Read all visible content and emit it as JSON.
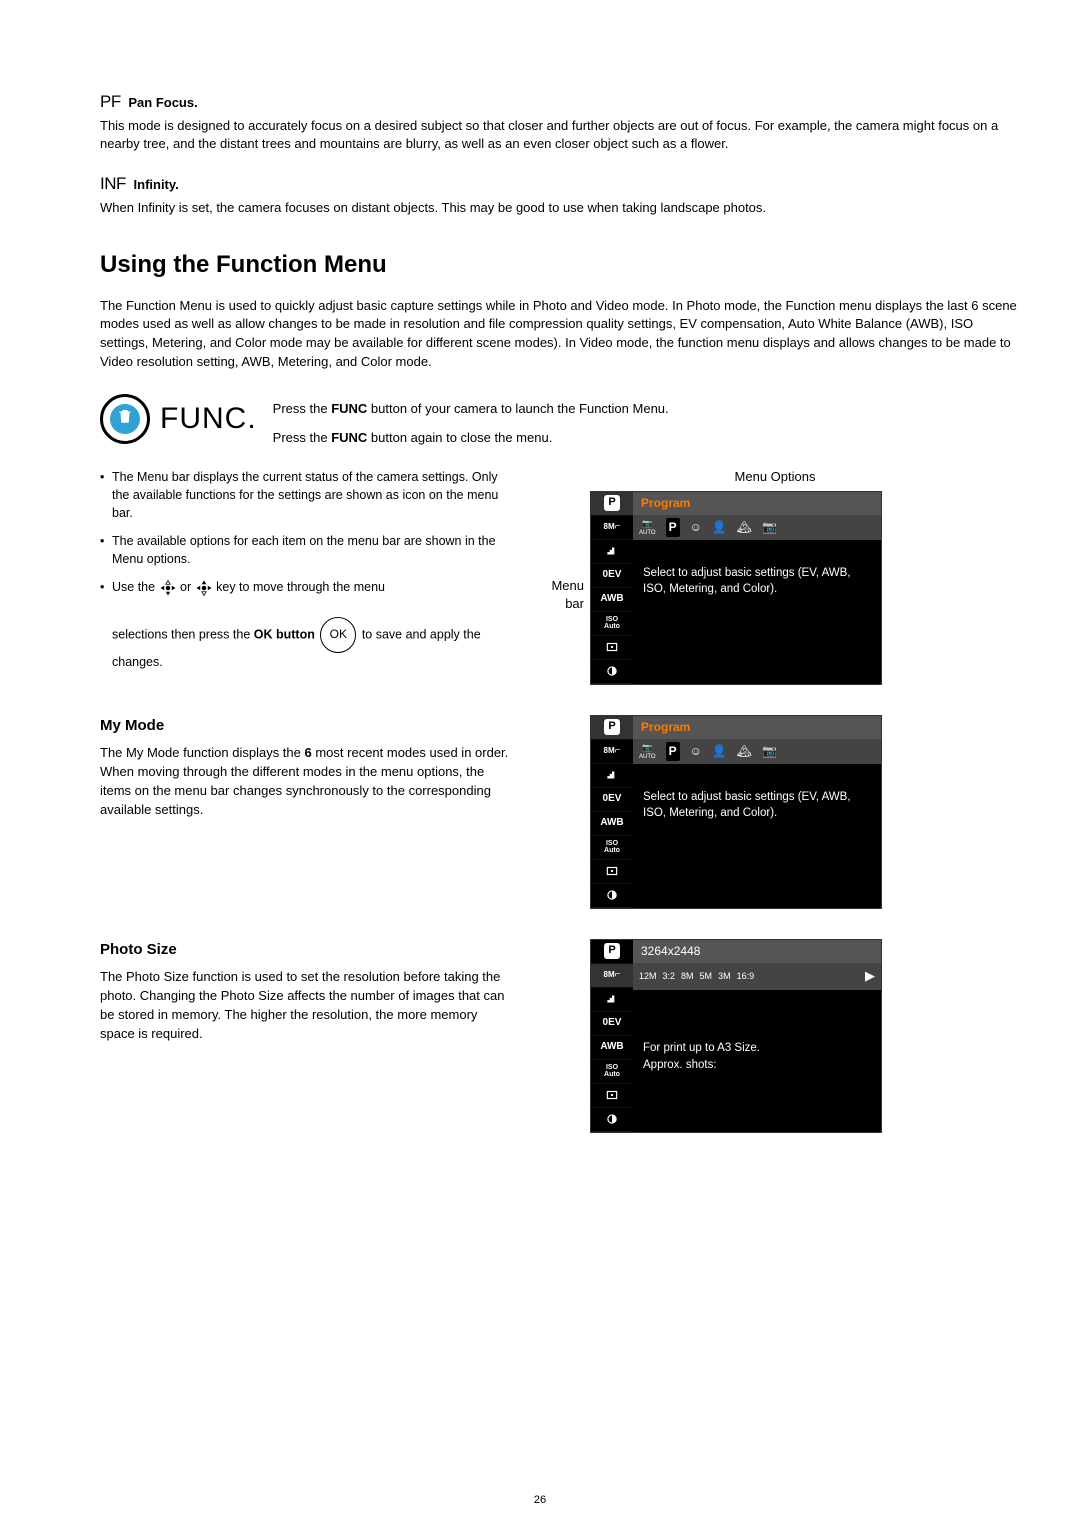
{
  "panfocus": {
    "prefix": "PF",
    "title": "Pan Focus.",
    "body": "This mode is designed to accurately focus on a desired subject so that closer and further objects are out of focus. For example, the camera might focus on a nearby tree, and the distant trees and mountains are blurry, as well as an even closer object such as a flower."
  },
  "infinity": {
    "prefix": "INF",
    "title": "Infinity.",
    "body": "When Infinity is set, the camera focuses on distant objects. This may be good to use when taking landscape photos."
  },
  "heading": "Using the Function Menu",
  "intro": "The Function Menu is used to quickly adjust basic capture settings while in Photo and Video mode. In Photo mode, the Function menu displays the last 6 scene modes used as well as allow changes to be made in resolution and file compression quality settings, EV compensation, Auto White Balance (AWB), ISO settings, Metering, and Color mode may be available for different scene modes). In Video mode, the function menu displays and allows changes to be made to Video resolution setting, AWB, Metering, and Color mode.",
  "func_label": "FUNC.",
  "func_line1_a": "Press the ",
  "func_line1_b": "FUNC",
  "func_line1_c": " button of your camera to launch the Function Menu.",
  "func_line2_a": "Press the ",
  "func_line2_b": "FUNC",
  "func_line2_c": " button again to close the menu.",
  "bullets": {
    "b1": "The Menu bar displays the current status of the camera settings. Only the available functions for the settings are shown as icon on the menu bar.",
    "b2": "The available options for each item on the menu bar are shown in the Menu options.",
    "b3a": "Use the ",
    "b3b": " or ",
    "b3c": " key to move through the menu",
    "b4a": "selections then press the ",
    "b4b": "OK button",
    "b4c": " to save and apply the changes."
  },
  "ok_label": "OK",
  "labels": {
    "menu_options": "Menu Options",
    "menu_bar": "Menu bar"
  },
  "screen": {
    "program": "Program",
    "size": "8M",
    "ev": "0EV",
    "awb": "AWB",
    "iso": "ISO Auto",
    "hint": "Select to adjust basic settings (EV, AWB, ISO, Metering, and Color).",
    "auto_small": "AUTO"
  },
  "mymode": {
    "title": "My Mode",
    "body_a": "The My Mode function displays the ",
    "body_b": "6",
    "body_c": " most recent modes used in order. When moving through the different modes in the menu options, the items on the menu bar changes synchronously to the corresponding available settings."
  },
  "photosize": {
    "title": "Photo Size",
    "body": "The Photo Size function is used to set the resolution before taking the photo. Changing the Photo Size affects the number of images that can be stored in memory. The higher the resolution, the more memory space is required.",
    "screen_title": "3264x2448",
    "opts": [
      "12M",
      "3:2",
      "8M",
      "5M",
      "3M",
      "16:9"
    ],
    "hint1": "For print up to A3 Size.",
    "hint2": "Approx. shots:"
  },
  "page_number": "26"
}
